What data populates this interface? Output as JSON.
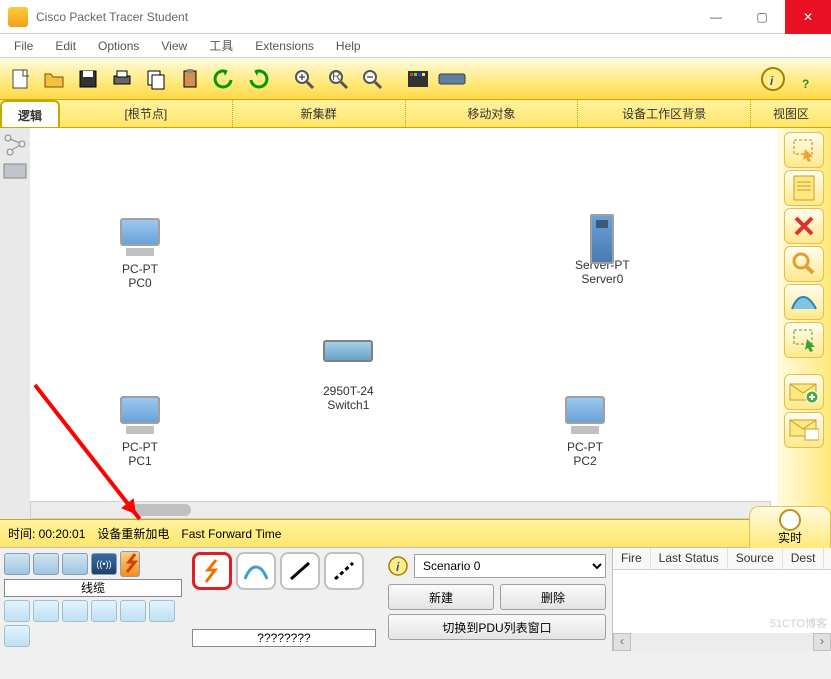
{
  "window": {
    "title": "Cisco Packet Tracer Student",
    "minimize": "—",
    "maximize": "▢",
    "close": "✕"
  },
  "menu": [
    "File",
    "Edit",
    "Options",
    "View",
    "工具",
    "Extensions",
    "Help"
  ],
  "nav": {
    "logic": "逻辑",
    "root": "[根节点]",
    "newcluster": "新集群",
    "move": "移动对象",
    "bg": "设备工作区背景",
    "viewport": "视图区"
  },
  "devices": {
    "pc0": {
      "type": "PC-PT",
      "name": "PC0"
    },
    "pc1": {
      "type": "PC-PT",
      "name": "PC1"
    },
    "pc2": {
      "type": "PC-PT",
      "name": "PC2"
    },
    "server0": {
      "type": "Server-PT",
      "name": "Server0"
    },
    "switch1": {
      "type": "2950T-24",
      "name": "Switch1"
    }
  },
  "timebar": {
    "time_label": "时间: 00:20:01",
    "repower": "设备重新加电",
    "fastfwd": "Fast Forward Time",
    "realtime": "实时"
  },
  "device_category_label": "线缆",
  "connection_label": "????????",
  "scenario": {
    "selected": "Scenario 0",
    "new_btn": "新建",
    "delete_btn": "删除",
    "switch_btn": "切换到PDU列表窗口"
  },
  "status_headers": [
    "Fire",
    "Last Status",
    "Source",
    "Dest"
  ],
  "watermark": "51CTO博客"
}
